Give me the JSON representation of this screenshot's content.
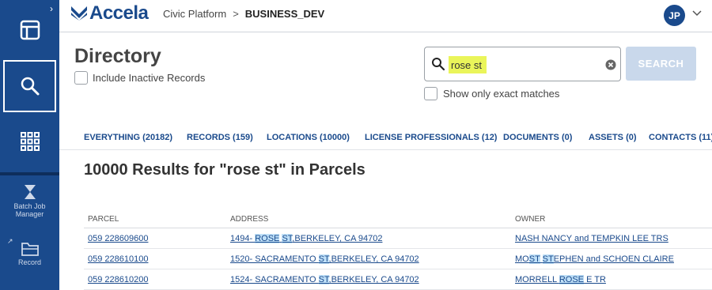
{
  "app": {
    "logo_text": "Accela",
    "breadcrumb": [
      "Civic Platform",
      "BUSINESS_DEV"
    ],
    "user_initials": "JP"
  },
  "rail": {
    "tools": [
      {
        "label": "Batch Job Manager"
      },
      {
        "label": "Record"
      }
    ]
  },
  "directory": {
    "title": "Directory",
    "include_inactive_label": "Include Inactive Records",
    "exact_matches_label": "Show only exact matches"
  },
  "search": {
    "value": "rose st",
    "button_label": "SEARCH"
  },
  "tabs": [
    {
      "label": "EVERYTHING (20182)"
    },
    {
      "label": "RECORDS (159)"
    },
    {
      "label": "LOCATIONS (10000)"
    },
    {
      "label": "LICENSE PROFESSIONALS (12)"
    },
    {
      "label": "DOCUMENTS (0)"
    },
    {
      "label": "ASSETS (0)"
    },
    {
      "label": "CONTACTS (11)"
    }
  ],
  "results": {
    "title": "10000 Results for \"rose st\" in Parcels",
    "columns": [
      "PARCEL",
      "ADDRESS",
      "OWNER"
    ],
    "rows": [
      {
        "parcel": "059 228609600",
        "address": [
          {
            "t": "1494- "
          },
          {
            "t": "ROSE",
            "hl": true
          },
          {
            "t": " "
          },
          {
            "t": "ST",
            "hl": true
          },
          {
            "t": ",BERKELEY, CA 94702"
          }
        ],
        "owner": [
          {
            "t": "NASH NANCY and TEMPKIN LEE TRS"
          }
        ]
      },
      {
        "parcel": "059 228610100",
        "address": [
          {
            "t": "1520- SACRAMENTO "
          },
          {
            "t": "ST",
            "hl": true
          },
          {
            "t": ",BERKELEY, CA 94702"
          }
        ],
        "owner": [
          {
            "t": "MO"
          },
          {
            "t": "ST",
            "hl": true
          },
          {
            "t": " "
          },
          {
            "t": "ST",
            "hl": true
          },
          {
            "t": "EPHEN and SCHOEN CLAIRE"
          }
        ]
      },
      {
        "parcel": "059 228610200",
        "address": [
          {
            "t": "1524- SACRAMENTO "
          },
          {
            "t": "ST",
            "hl": true
          },
          {
            "t": ",BERKELEY, CA 94702"
          }
        ],
        "owner": [
          {
            "t": "MORRELL "
          },
          {
            "t": "ROSE",
            "hl": true
          },
          {
            "t": " E TR"
          }
        ]
      }
    ]
  },
  "icons": {
    "rail": [
      "layout-icon",
      "search-icon",
      "grid-icon"
    ],
    "search_clear": "clear-icon"
  },
  "colors": {
    "brand": "#1a4a8c",
    "search_highlight": "#eaf55a",
    "match_highlight": "#bfe0f8"
  }
}
